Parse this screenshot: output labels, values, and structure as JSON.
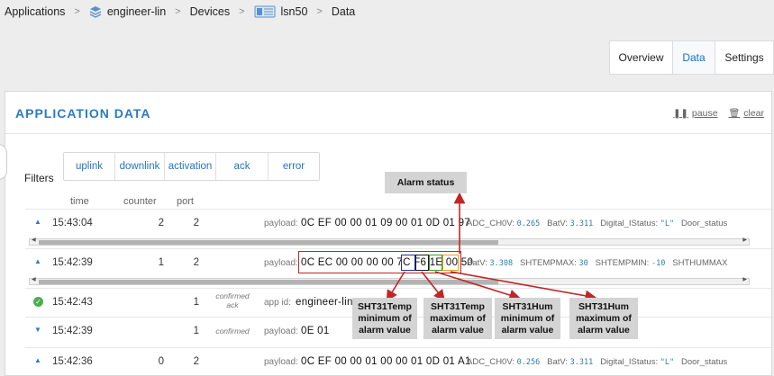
{
  "breadcrumb": {
    "items": [
      "Applications",
      "engineer-lin",
      "Devices",
      "lsn50",
      "Data"
    ],
    "separator": ">"
  },
  "tabs": [
    "Overview",
    "Data",
    "Settings"
  ],
  "panel": {
    "title": "APPLICATION DATA",
    "pause": "pause",
    "clear": "clear"
  },
  "filters": {
    "label": "Filters",
    "options": [
      "uplink",
      "downlink",
      "activation",
      "ack",
      "error"
    ]
  },
  "columns": {
    "time": "time",
    "counter": "counter",
    "port": "port"
  },
  "rows": [
    {
      "icon": "uplink-arrow-icon",
      "time": "15:43:04",
      "counter": "2",
      "port": "2",
      "label": "payload:",
      "value": "0C EF 00 00 01 09 00 01 0D 01 97",
      "f1k": "ADC_CH0V:",
      "f1v": "0.265",
      "f2k": "BatV:",
      "f2v": "3.311",
      "f3k": "Digital_IStatus:",
      "f3v": "\"L\"",
      "f4k": "Door_status",
      "f4v": ""
    },
    {
      "icon": "uplink-arrow-icon",
      "time": "15:42:39",
      "counter": "1",
      "port": "2",
      "label": "payload:",
      "value": "0C EC 00 00 00 00 7C F6 1E 00 50",
      "f1k": "BatV:",
      "f1v": "3.308",
      "f2k": "SHTEMPMAX:",
      "f2v": "30",
      "f3k": "SHTEMPMIN:",
      "f3v": "-10",
      "f4k": "SHTHUMMAX",
      "f4v": ""
    },
    {
      "icon": "check-circle-icon",
      "time": "15:42:43",
      "counter": "",
      "port": "1",
      "kind": [
        "confirmed",
        "ack"
      ],
      "label": "app id:",
      "value": "engineer-lin"
    },
    {
      "icon": "downlink-arrow-icon",
      "time": "15:42:39",
      "counter": "",
      "port": "1",
      "kind": [
        "confirmed"
      ],
      "label": "payload:",
      "value": "0E 01"
    },
    {
      "icon": "uplink-arrow-icon",
      "time": "15:42:36",
      "counter": "0",
      "port": "2",
      "label": "payload:",
      "value": "0C EF 00 00 01 00 00 01 0D 01 A1",
      "f1k": "ADC_CH0V:",
      "f1v": "0.256",
      "f2k": "BatV:",
      "f2v": "3.311",
      "f3k": "Digital_IStatus:",
      "f3v": "\"L\"",
      "f4k": "Door_status",
      "f4v": ""
    }
  ],
  "annotations": {
    "alarm": "Alarm status",
    "temp_min": [
      "SHT31Temp",
      "minimum of",
      "alarm value"
    ],
    "temp_max": [
      "SHT31Temp",
      "maximum of",
      "alarm value"
    ],
    "hum_min": [
      "SHT31Hum",
      "minimum of",
      "alarm value"
    ],
    "hum_max": [
      "SHT31Hum",
      "maximum of",
      "alarm value"
    ],
    "colors": {
      "red": "#c12626",
      "blue": "#1f2fa8",
      "green": "#3a9a2a",
      "orange": "#e7a11a"
    }
  }
}
